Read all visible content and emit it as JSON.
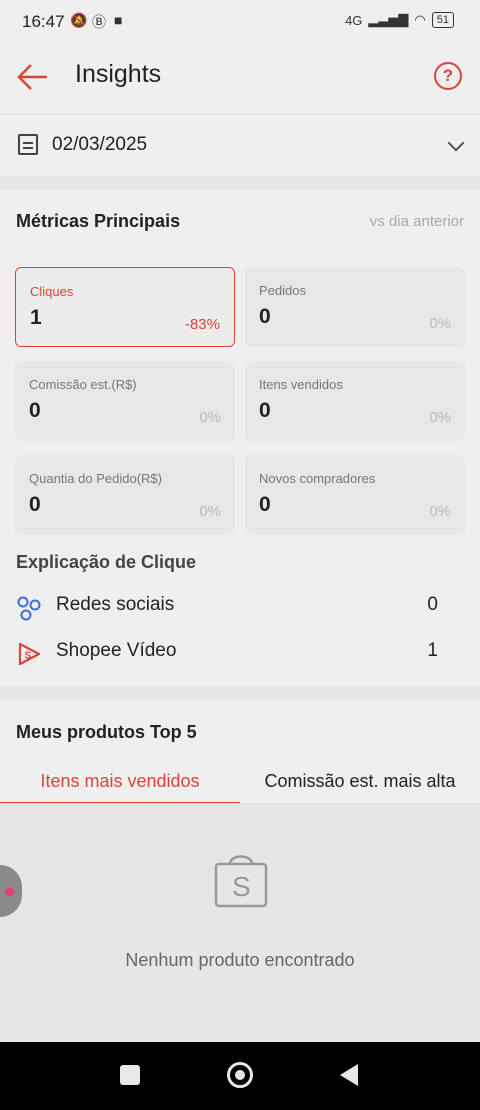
{
  "status_bar": {
    "time": "16:47",
    "network": "4G",
    "battery": "51"
  },
  "header": {
    "title": "Insights"
  },
  "date_filter": {
    "value": "02/03/2025"
  },
  "metrics": {
    "title": "Métricas Principais",
    "comparison": "vs dia anterior",
    "cards": [
      {
        "label": "Cliques",
        "value": "1",
        "change": "-83%"
      },
      {
        "label": "Pedidos",
        "value": "0",
        "change": "0%"
      },
      {
        "label": "Comissão est.(R$)",
        "value": "0",
        "change": "0%"
      },
      {
        "label": "Itens vendidos",
        "value": "0",
        "change": "0%"
      },
      {
        "label": "Quantia do Pedido(R$)",
        "value": "0",
        "change": "0%"
      },
      {
        "label": "Novos compradores",
        "value": "0",
        "change": "0%"
      }
    ]
  },
  "click_breakdown": {
    "title": "Explicação de Clique",
    "rows": [
      {
        "label": "Redes sociais",
        "count": "0",
        "icon": "social-network-icon"
      },
      {
        "label": "Shopee Vídeo",
        "count": "1",
        "icon": "shopee-video-icon"
      }
    ]
  },
  "top_products": {
    "title": "Meus produtos Top 5",
    "tabs": [
      "Itens mais vendidos",
      "Comissão est. mais alta"
    ],
    "empty_message": "Nenhum produto encontrado"
  },
  "colors": {
    "accent": "#d9453a",
    "background": "#efefef"
  }
}
